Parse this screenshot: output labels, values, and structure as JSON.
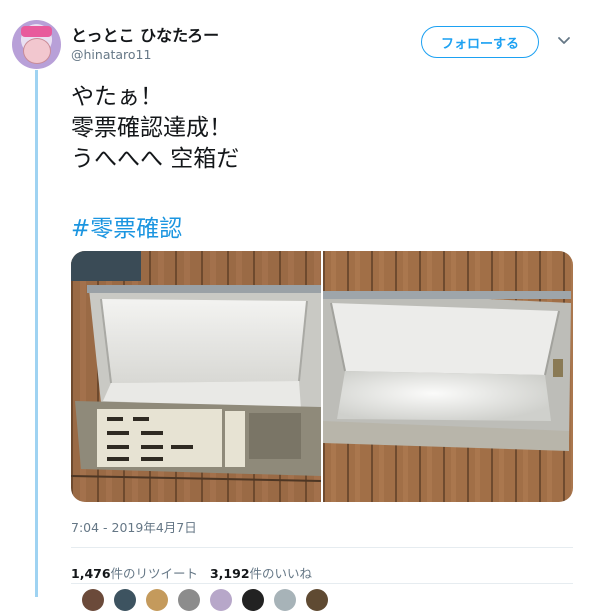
{
  "user": {
    "display_name": "とっとこ ひなたろー",
    "handle": "@hinataro11"
  },
  "follow_button_label": "フォローする",
  "tweet_lines": [
    "やたぁ！",
    "零票確認達成！",
    "うへへへ 空箱だ"
  ],
  "hashtag": "#零票確認",
  "timestamp": "7:04 - 2019年4月7日",
  "stats": {
    "retweets_count": "1,476",
    "retweets_label": "件のリツイート",
    "likes_count": "3,192",
    "likes_label": "件のいいね"
  },
  "colors": {
    "accent": "#1da1f2",
    "hashtag": "#1b95e0",
    "thread_line": "#9fd3f2",
    "secondary_text": "#657786"
  },
  "icons": [
    "chevron-down-icon"
  ]
}
